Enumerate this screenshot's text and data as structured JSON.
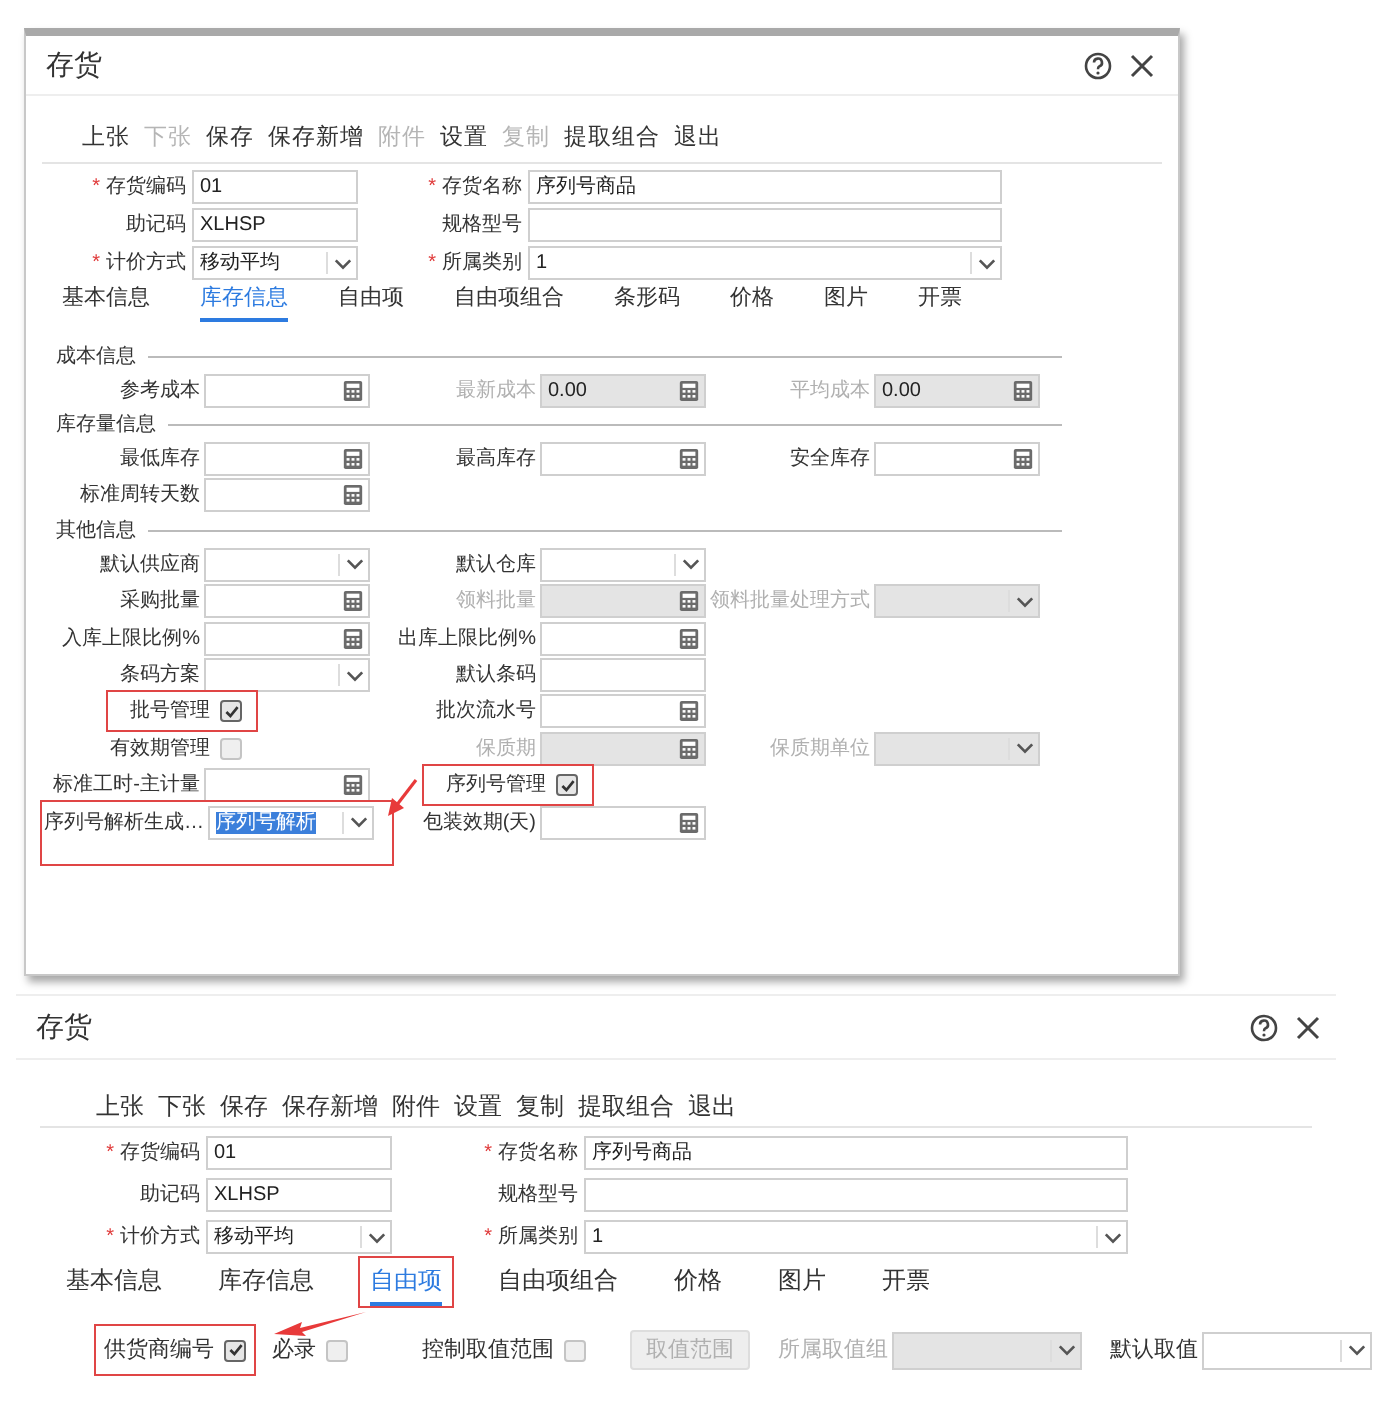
{
  "dialogs": [
    {
      "title": "存货",
      "toolbar": [
        {
          "label": "上张",
          "disabled": false
        },
        {
          "label": "下张",
          "disabled": true
        },
        {
          "label": "保存",
          "disabled": false
        },
        {
          "label": "保存新增",
          "disabled": false
        },
        {
          "label": "附件",
          "disabled": true
        },
        {
          "label": "设置",
          "disabled": false
        },
        {
          "label": "复制",
          "disabled": true
        },
        {
          "label": "提取组合",
          "disabled": false
        },
        {
          "label": "退出",
          "disabled": false
        }
      ],
      "header_rows": [
        [
          {
            "required_mark": "*",
            "label": "存货编码",
            "kind": "text",
            "value": "01"
          },
          {
            "required_mark": "*",
            "label": "存货名称",
            "kind": "text",
            "value": "序列号商品"
          }
        ],
        [
          {
            "label": "助记码",
            "kind": "text",
            "value": "XLHSP"
          },
          {
            "label": "规格型号",
            "kind": "text"
          }
        ],
        [
          {
            "required_mark": "*",
            "label": "计价方式",
            "kind": "select",
            "value": "移动平均"
          },
          {
            "required_mark": "*",
            "label": "所属类别",
            "kind": "select",
            "value": "1"
          }
        ]
      ],
      "tabs": [
        {
          "label": "基本信息",
          "selected": false,
          "highlighted": false
        },
        {
          "label": "库存信息",
          "selected": true,
          "highlighted": false
        },
        {
          "label": "自由项",
          "selected": false,
          "highlighted": false
        },
        {
          "label": "自由项组合",
          "selected": false,
          "highlighted": false
        },
        {
          "label": "条形码",
          "selected": false,
          "highlighted": false
        },
        {
          "label": "价格",
          "selected": false,
          "highlighted": false
        },
        {
          "label": "图片",
          "selected": false,
          "highlighted": false
        },
        {
          "label": "开票",
          "selected": false,
          "highlighted": false
        }
      ],
      "sections": [
        {
          "title": "成本信息",
          "rows": [
            [
              {
                "label": "参考成本",
                "kind": "number",
                "disabled": false,
                "highlighted": false
              },
              {
                "label": "最新成本",
                "kind": "number",
                "value": "0.00",
                "disabled": true,
                "highlighted": false
              },
              {
                "label": "平均成本",
                "kind": "number",
                "value": "0.00",
                "disabled": true,
                "highlighted": false
              }
            ]
          ]
        },
        {
          "title": "库存量信息",
          "rows": [
            [
              {
                "label": "最低库存",
                "kind": "number",
                "disabled": false,
                "highlighted": false
              },
              {
                "label": "最高库存",
                "kind": "number",
                "disabled": false,
                "highlighted": false
              },
              {
                "label": "安全库存",
                "kind": "number",
                "disabled": false,
                "highlighted": false
              }
            ],
            [
              {
                "label": "标准周转天数",
                "kind": "number",
                "disabled": false,
                "highlighted": false
              }
            ]
          ]
        },
        {
          "title": "其他信息",
          "rows": [
            [
              {
                "label": "默认供应商",
                "kind": "select",
                "disabled": false,
                "highlighted": false
              },
              {
                "label": "默认仓库",
                "kind": "select",
                "disabled": false,
                "highlighted": false
              }
            ],
            [
              {
                "label": "采购批量",
                "kind": "number",
                "disabled": false,
                "highlighted": false
              },
              {
                "label": "领料批量",
                "kind": "number",
                "disabled": true,
                "highlighted": false
              },
              {
                "label": "领料批量处理方式",
                "kind": "select",
                "disabled": true,
                "highlighted": false
              }
            ],
            [
              {
                "label": "入库上限比例%",
                "kind": "number",
                "disabled": false,
                "highlighted": false
              },
              {
                "label": "出库上限比例%",
                "kind": "number",
                "disabled": false,
                "highlighted": false
              }
            ],
            [
              {
                "label": "条码方案",
                "kind": "select",
                "disabled": false,
                "highlighted": false
              },
              {
                "label": "默认条码",
                "kind": "text",
                "disabled": false,
                "highlighted": false
              }
            ],
            [
              {
                "label": "批号管理",
                "kind": "checkbox",
                "checked": true,
                "disabled": false,
                "highlighted": true
              },
              {
                "label": "批次流水号",
                "kind": "number",
                "disabled": false,
                "highlighted": false
              }
            ],
            [
              {
                "label": "有效期管理",
                "kind": "checkbox",
                "checked": false,
                "disabled": false,
                "highlighted": false
              },
              {
                "label": "保质期",
                "kind": "number",
                "disabled": true,
                "highlighted": false
              },
              {
                "label": "保质期单位",
                "kind": "select",
                "disabled": true,
                "highlighted": false
              }
            ],
            [
              {
                "label": "标准工时-主计量",
                "kind": "number",
                "disabled": false,
                "highlighted": false
              },
              {
                "label": "序列号管理",
                "kind": "checkbox",
                "checked": true,
                "disabled": false,
                "highlighted": true
              }
            ],
            [
              {
                "label": "序列号解析生成…",
                "kind": "select",
                "value": "序列号解析",
                "focused": true,
                "disabled": false,
                "highlighted": true
              },
              {
                "label": "包装效期(天)",
                "kind": "number",
                "disabled": false,
                "highlighted": false
              }
            ]
          ]
        }
      ]
    },
    {
      "title": "存货",
      "toolbar": [
        {
          "label": "上张",
          "disabled": false
        },
        {
          "label": "下张",
          "disabled": false
        },
        {
          "label": "保存",
          "disabled": false
        },
        {
          "label": "保存新增",
          "disabled": false
        },
        {
          "label": "附件",
          "disabled": false
        },
        {
          "label": "设置",
          "disabled": false
        },
        {
          "label": "复制",
          "disabled": false
        },
        {
          "label": "提取组合",
          "disabled": false
        },
        {
          "label": "退出",
          "disabled": false
        }
      ],
      "header_rows": [
        [
          {
            "required_mark": "*",
            "label": "存货编码",
            "kind": "text",
            "value": "01"
          },
          {
            "required_mark": "*",
            "label": "存货名称",
            "kind": "text",
            "value": "序列号商品"
          }
        ],
        [
          {
            "label": "助记码",
            "kind": "text",
            "value": "XLHSP"
          },
          {
            "label": "规格型号",
            "kind": "text"
          }
        ],
        [
          {
            "required_mark": "*",
            "label": "计价方式",
            "kind": "select",
            "value": "移动平均"
          },
          {
            "required_mark": "*",
            "label": "所属类别",
            "kind": "select",
            "value": "1"
          }
        ]
      ],
      "tabs": [
        {
          "label": "基本信息",
          "selected": false,
          "highlighted": false
        },
        {
          "label": "库存信息",
          "selected": false,
          "highlighted": false
        },
        {
          "label": "自由项",
          "selected": true,
          "highlighted": true
        },
        {
          "label": "自由项组合",
          "selected": false,
          "highlighted": false
        },
        {
          "label": "价格",
          "selected": false,
          "highlighted": false
        },
        {
          "label": "图片",
          "selected": false,
          "highlighted": false
        },
        {
          "label": "开票",
          "selected": false,
          "highlighted": false
        }
      ],
      "free_item_controls": [
        {
          "kind": "checkbox",
          "label": "供货商编号",
          "checked": true,
          "disabled": false,
          "highlighted": true
        },
        {
          "kind": "checkbox",
          "label": "必录",
          "checked": false,
          "disabled": false,
          "highlighted": false
        },
        {
          "kind": "checkbox",
          "label": "控制取值范围",
          "checked": false,
          "disabled": false,
          "highlighted": false
        },
        {
          "kind": "button",
          "label": "取值范围",
          "disabled": true,
          "highlighted": false
        },
        {
          "kind": "select",
          "label": "所属取值组",
          "disabled": true,
          "highlighted": false
        },
        {
          "kind": "select",
          "label": "默认取值",
          "disabled": false,
          "highlighted": false
        }
      ]
    }
  ]
}
